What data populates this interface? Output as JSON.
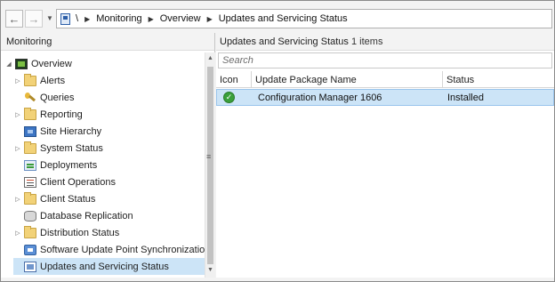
{
  "address_bar": {
    "root": "\\",
    "segments": [
      "Monitoring",
      "Overview",
      "Updates and Servicing Status"
    ]
  },
  "nav": {
    "title": "Monitoring",
    "root_item": "Overview",
    "items": [
      {
        "label": "Alerts",
        "icon": "folder-icon",
        "expandable": true
      },
      {
        "label": "Queries",
        "icon": "query-icon",
        "expandable": false
      },
      {
        "label": "Reporting",
        "icon": "folder-icon",
        "expandable": true
      },
      {
        "label": "Site Hierarchy",
        "icon": "site-hierarchy-icon",
        "expandable": false
      },
      {
        "label": "System Status",
        "icon": "folder-icon",
        "expandable": true
      },
      {
        "label": "Deployments",
        "icon": "deployments-icon",
        "expandable": false
      },
      {
        "label": "Client Operations",
        "icon": "client-operations-icon",
        "expandable": false
      },
      {
        "label": "Client Status",
        "icon": "folder-icon",
        "expandable": true
      },
      {
        "label": "Database Replication",
        "icon": "database-icon",
        "expandable": false
      },
      {
        "label": "Distribution Status",
        "icon": "folder-icon",
        "expandable": true
      },
      {
        "label": "Software Update Point Synchronization Sta",
        "icon": "sync-icon",
        "expandable": false
      },
      {
        "label": "Updates and Servicing Status",
        "icon": "servicing-icon",
        "expandable": false,
        "selected": true
      }
    ]
  },
  "content": {
    "title": "Updates and Servicing Status",
    "count": "1 items",
    "search_placeholder": "Search",
    "columns": [
      "Icon",
      "Update Package Name",
      "Status"
    ],
    "rows": [
      {
        "icon": "installed-check-icon",
        "name": "Configuration Manager 1606",
        "status": "Installed"
      }
    ]
  }
}
